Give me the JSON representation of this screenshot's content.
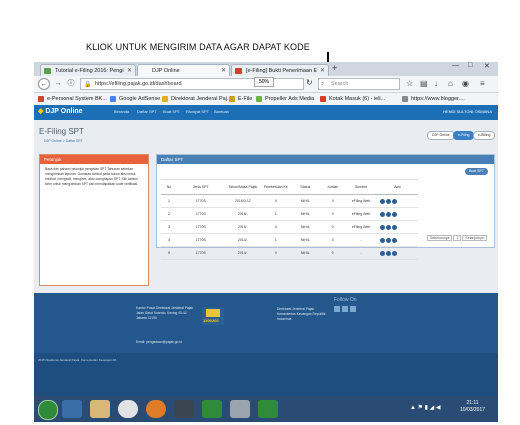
{
  "annotation": {
    "caption": "KLIOK UNTUK MENGIRIM  DATA AGAR DAPAT KODE"
  },
  "browser": {
    "tabs": [
      {
        "label": "Tutorial e-Filing 2016: Pengi",
        "active": false
      },
      {
        "label": "DJP Online",
        "active": true
      },
      {
        "label": "[e-Filing] Bukti Penerimaan E",
        "active": false
      }
    ],
    "url": "https://efiling.pajak.go.id/dashboard",
    "zoom": "50%",
    "search_placeholder": "Search",
    "bookmarks": [
      "e-Personal System BK...",
      "Google AdSense",
      "Direktorat Jenderal Paj...",
      "E-File",
      "Propeller Ads Media",
      "Kotak Masuk (6) - ieli...",
      "https://www.blogger...."
    ]
  },
  "app": {
    "logo": "DJP Online",
    "menu": [
      "Beranda",
      "Daftar SPT",
      "Buat SPT",
      "Riwayat SPT",
      "Bantuan"
    ],
    "user": "HENDI SULTONI OSMANA",
    "page_title": "E-Filing SPT",
    "breadcrumb": "DJP Online  >  Daftar SPT",
    "pills": [
      "DJP Online",
      "e-Filing",
      "e-Billing"
    ],
    "left_panel": {
      "title": "Petunjuk",
      "text": "Baca dan pahami petunjuk pengisian SPT Tahunan sebelum mengirimkan laporan. Gunakan tombol pada kolom aksi untuk melihat, mengedit, mengirim, atau menghapus SPT. Klik tombol kirim untuk mengirimkan SPT dan mendapatkan kode verifikasi."
    },
    "right_panel": {
      "title": "Daftar SPT",
      "new_button": "Buat SPT",
      "columns": [
        "No",
        "Jenis SPT",
        "Tahun/Masa Pajak",
        "Pembetulan Ke",
        "Status",
        "Jumlah",
        "Sumber",
        "Aksi"
      ],
      "rows": [
        [
          "1",
          "1770S",
          "2016/0-12",
          "0",
          "NIHIL",
          "0",
          "eFiling Web"
        ],
        [
          "2",
          "1770S",
          "2016/-",
          "1",
          "NIHIL",
          "0",
          "eFiling Web"
        ],
        [
          "3",
          "1770S",
          "2016/-",
          "0",
          "NIHIL",
          "0",
          "eFiling Web"
        ],
        [
          "4",
          "1770S",
          "2014/-",
          "1",
          "NIHIL",
          "0",
          "-"
        ],
        [
          "5",
          "1770S",
          "2014/-",
          "0",
          "NIHIL",
          "0",
          "-"
        ]
      ],
      "pager": {
        "prev": "Sebelumnya",
        "page": "1",
        "next": "Selanjutnya"
      }
    }
  },
  "footer": {
    "address": [
      "Kantor Pusat Direktorat Jenderal Pajak",
      "Jalan Gatot Subroto, Kaving 40-42",
      "Jakarta 12190"
    ],
    "email_label": "Email: pengaduan@pajak.go.id",
    "links": [
      "Direktorat Jenderal Pajak",
      "Kementerian Keuangan Republik",
      "Indonesia"
    ],
    "follow": "Follow On",
    "copyright": "2015 Direktorat Jenderal Pajak, Kementerian Keuangan RI",
    "callcenter": "1500200"
  },
  "taskbar": {
    "time": "21:11",
    "date": "10/03/2017"
  }
}
